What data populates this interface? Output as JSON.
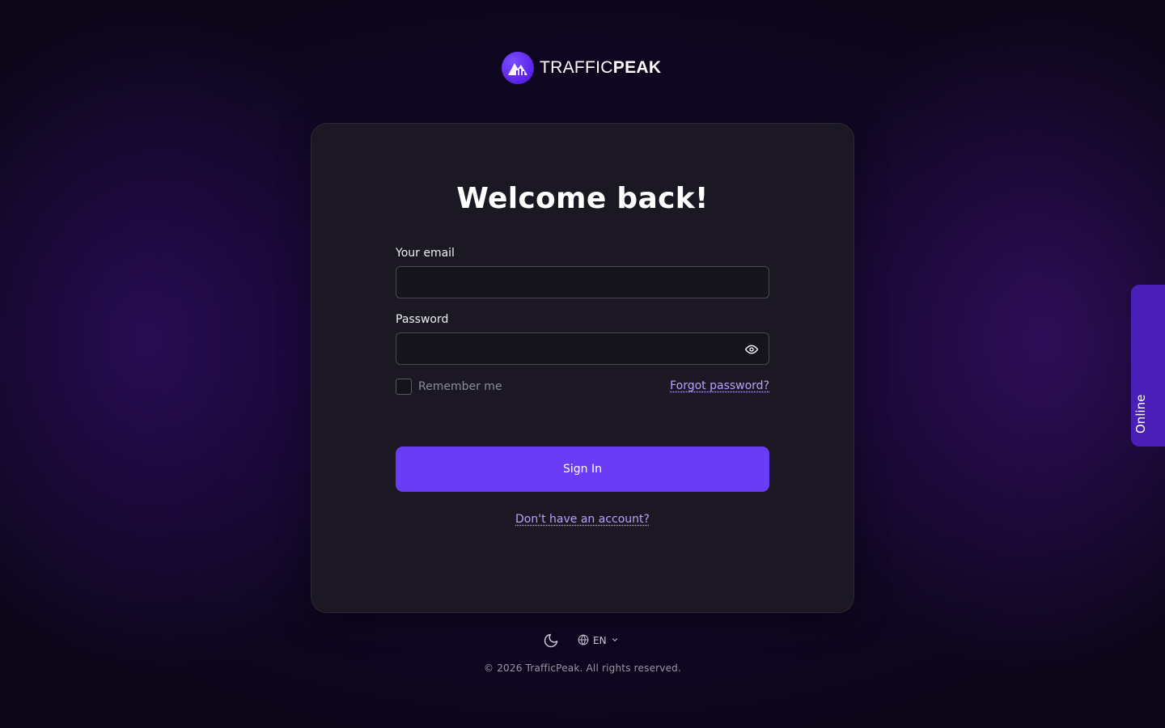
{
  "brand": {
    "name_light": "TRAFFIC",
    "name_bold": "PEAK",
    "logo_icon": "peak-chart-icon",
    "accent_color": "#6b3cf5"
  },
  "login": {
    "title": "Welcome back!",
    "email_label": "Your email",
    "email_value": "",
    "email_placeholder": "",
    "password_label": "Password",
    "password_value": "",
    "password_placeholder": "",
    "password_toggle_icon": "eye-icon",
    "remember_label": "Remember me",
    "remember_checked": false,
    "forgot_label": "Forgot password?",
    "signin_label": "Sign In",
    "signup_label": "Don't have an account?"
  },
  "footer": {
    "theme_icon": "moon-icon",
    "language_icon": "globe-icon",
    "language": "EN",
    "copyright": "© 2026 TrafficPeak. All rights reserved."
  },
  "status_tab": {
    "label": "Online"
  }
}
